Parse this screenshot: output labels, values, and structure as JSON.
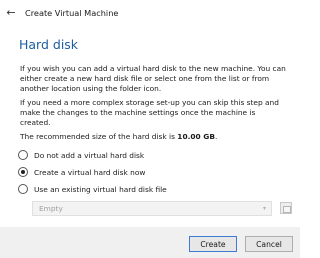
{
  "window": {
    "title": "Create Virtual Machine",
    "back_icon": "←"
  },
  "page": {
    "heading": "Hard disk",
    "paragraph1": "If you wish you can add a virtual hard disk to the new machine. You can either create a new hard disk file or select one from the list or from another location using the folder icon.",
    "paragraph2": "If you need a more complex storage set-up you can skip this step and make the changes to the machine settings once the machine is created.",
    "recommended_prefix": "The recommended size of the hard disk is ",
    "recommended_size": "10.00 GB",
    "recommended_suffix": "."
  },
  "options": {
    "no_disk": {
      "label": "Do not add a virtual hard disk",
      "checked": false
    },
    "create_now": {
      "label": "Create a virtual hard disk now",
      "checked": true
    },
    "use_existing": {
      "label": "Use an existing virtual hard disk file",
      "checked": false
    }
  },
  "existing_file": {
    "value": "Empty",
    "caret": "▾",
    "enabled": false
  },
  "footer": {
    "create_label": "Create",
    "cancel_label": "Cancel"
  },
  "colors": {
    "heading": "#1b5e9e",
    "default_button_border": "#3d7bd4"
  }
}
